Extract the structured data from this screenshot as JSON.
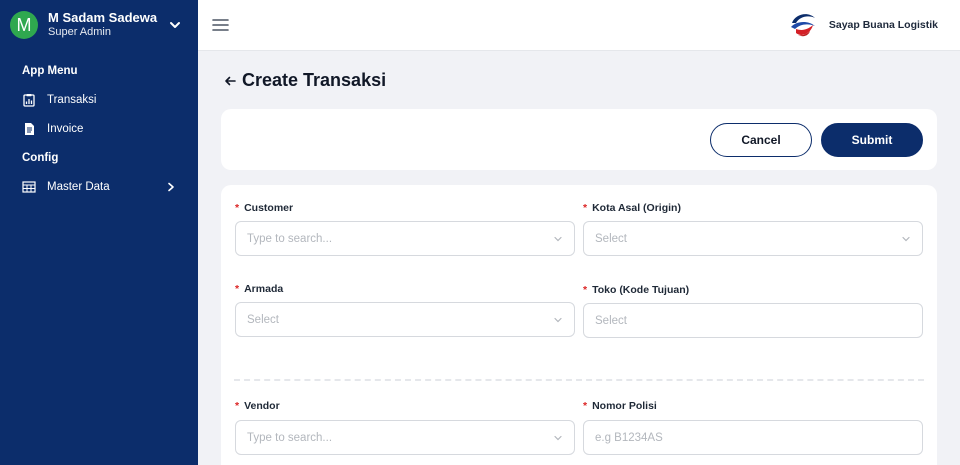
{
  "user": {
    "initial": "M",
    "name": "M Sadam Sadewa",
    "role": "Super Admin"
  },
  "sidebar": {
    "sections": [
      {
        "label": "App Menu",
        "items": [
          {
            "label": "Transaksi",
            "icon": "chart-clipboard-icon"
          },
          {
            "label": "Invoice",
            "icon": "document-icon"
          }
        ]
      },
      {
        "label": "Config",
        "items": [
          {
            "label": "Master Data",
            "icon": "table-icon"
          }
        ]
      }
    ]
  },
  "brand": {
    "name": "Sayap Buana Logistik"
  },
  "page": {
    "title": "Create Transaksi"
  },
  "actions": {
    "cancel": "Cancel",
    "submit": "Submit"
  },
  "form": {
    "customer": {
      "label": "Customer",
      "placeholder": "Type to search..."
    },
    "kota_asal": {
      "label": "Kota Asal (Origin)",
      "placeholder": "Select"
    },
    "armada": {
      "label": "Armada",
      "placeholder": "Select"
    },
    "toko": {
      "label": "Toko (Kode Tujuan)",
      "placeholder": "Select"
    },
    "vendor": {
      "label": "Vendor",
      "placeholder": "Type to search..."
    },
    "nomor_polisi": {
      "label": "Nomor Polisi",
      "placeholder": "e.g B1234AS"
    }
  },
  "colors": {
    "sidebar": "#0c2d6b",
    "primary": "#0c2d6b",
    "avatar": "#2fa84f",
    "required": "#dc2626"
  }
}
